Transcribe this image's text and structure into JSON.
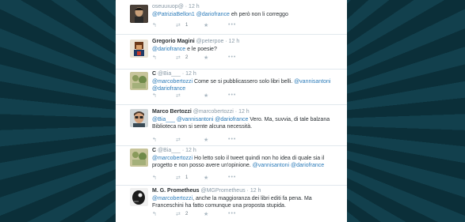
{
  "tweets": [
    {
      "name": "",
      "handle": "oseuuıuop@",
      "time": "12 h",
      "text_parts": [
        {
          "t": "@PatriziaBellon1",
          "m": true
        },
        {
          "t": " ",
          "m": false
        },
        {
          "t": "@dariofrance",
          "m": true
        },
        {
          "t": " eh però non li correggo",
          "m": false
        }
      ],
      "retweets": "1",
      "favorites": ""
    },
    {
      "name": "Gregorio Magini",
      "handle": "@peterpoe",
      "time": "12 h",
      "text_parts": [
        {
          "t": "@dariofrance",
          "m": true
        },
        {
          "t": " e le poesie?",
          "m": false
        }
      ],
      "retweets": "2",
      "favorites": ""
    },
    {
      "name": "C",
      "handle": "@Bia___",
      "time": "12 h",
      "text_parts": [
        {
          "t": "@marcobertozzi",
          "m": true
        },
        {
          "t": " Come se si pubblicassero solo libri belli. ",
          "m": false
        },
        {
          "t": "@vannisantoni",
          "m": true
        },
        {
          "t": " ",
          "m": false
        },
        {
          "t": "@dariofrance",
          "m": true
        }
      ],
      "retweets": "",
      "favorites": ""
    },
    {
      "name": "Marco Bertozzi",
      "handle": "@marcobertozzi",
      "time": "12 h",
      "text_parts": [
        {
          "t": "@Bia___",
          "m": true
        },
        {
          "t": " ",
          "m": false
        },
        {
          "t": "@vannisantoni",
          "m": true
        },
        {
          "t": " ",
          "m": false
        },
        {
          "t": "@dariofrance",
          "m": true
        },
        {
          "t": " Vero. Ma, suvvia, di tale balzana Biblioteca non si sente alcuna necessità.",
          "m": false
        }
      ],
      "retweets": "",
      "favorites": ""
    },
    {
      "name": "C",
      "handle": "@Bia___",
      "time": "12 h",
      "text_parts": [
        {
          "t": "@marcobertozzi",
          "m": true
        },
        {
          "t": " Ho letto solo il tweet quindi non ho idea di quale sia il progetto e non posso avere un'opinione. ",
          "m": false
        },
        {
          "t": "@vannisantoni",
          "m": true
        },
        {
          "t": " ",
          "m": false
        },
        {
          "t": "@dariofrance",
          "m": true
        }
      ],
      "retweets": "1",
      "favorites": ""
    },
    {
      "name": "M. G. Prometheus",
      "handle": "@MGPrometheus",
      "time": "12 h",
      "text_parts": [
        {
          "t": "@marcobertozzi",
          "m": true
        },
        {
          "t": ", anche la maggioranza dei libri editi fa pena. Ma Franceschini ha fatto comunque una proposta stupida.",
          "m": false
        }
      ],
      "retweets": "2",
      "favorites": ""
    }
  ],
  "icons": {
    "reply": "reply-icon",
    "retweet": "retweet-icon",
    "favorite": "star-icon",
    "more": "more-icon"
  },
  "colors": {
    "mention": "#2b7bb9",
    "name": "#292f33",
    "meta": "#8899a6"
  }
}
